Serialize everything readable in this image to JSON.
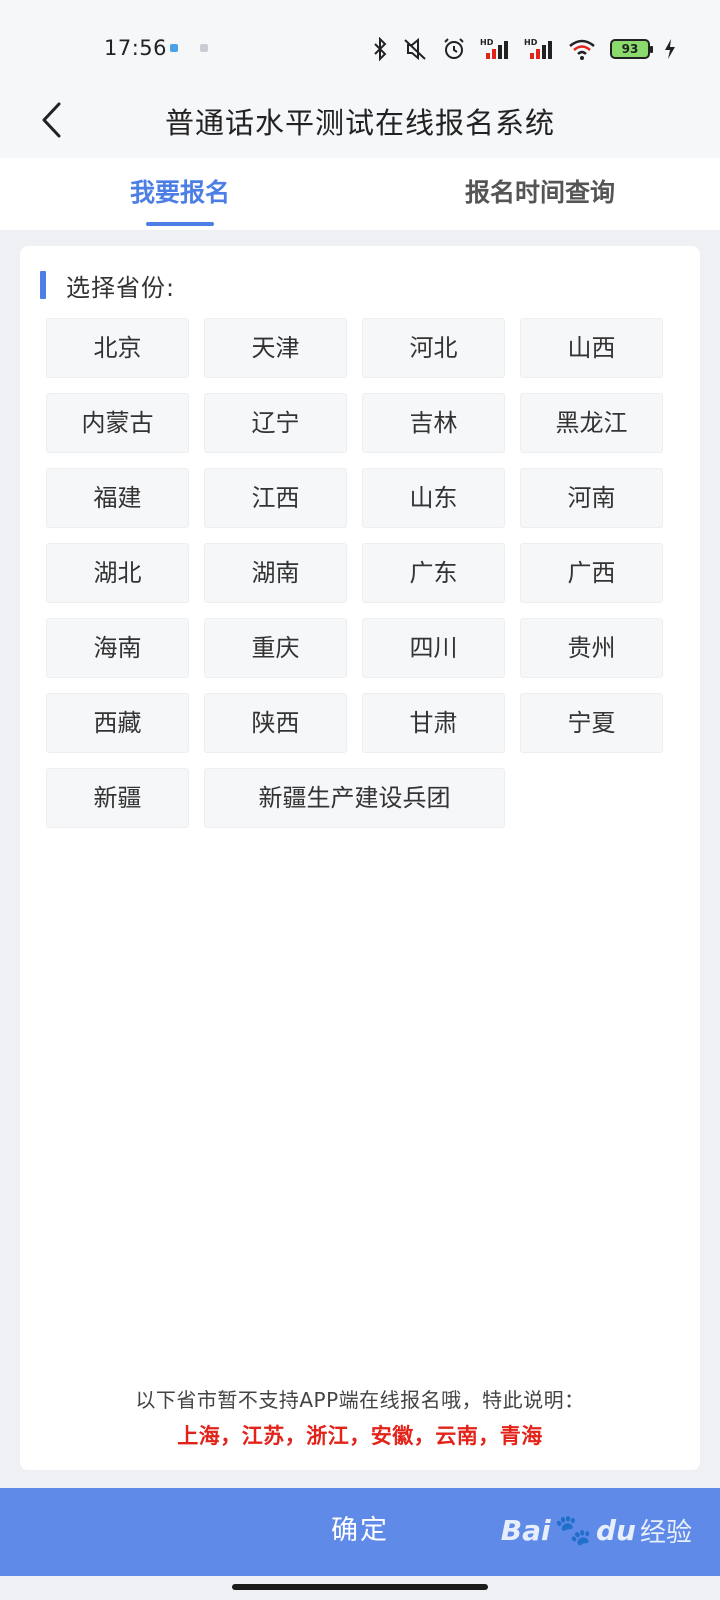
{
  "status_bar": {
    "time": "17:56",
    "icons": [
      "bluetooth-icon",
      "mute-icon",
      "alarm-icon",
      "signal-hd-icon",
      "signal-hd-icon",
      "wifi-icon",
      "battery-icon",
      "charging-icon"
    ],
    "battery_level": "93"
  },
  "header": {
    "title": "普通话水平测试在线报名系统",
    "back_icon": "chevron-left-icon"
  },
  "tabs": [
    {
      "label": "我要报名",
      "active": true
    },
    {
      "label": "报名时间查询",
      "active": false
    }
  ],
  "section": {
    "label": "选择省份:"
  },
  "provinces": [
    "北京",
    "天津",
    "河北",
    "山西",
    "内蒙古",
    "辽宁",
    "吉林",
    "黑龙江",
    "福建",
    "江西",
    "山东",
    "河南",
    "湖北",
    "湖南",
    "广东",
    "广西",
    "海南",
    "重庆",
    "四川",
    "贵州",
    "西藏",
    "陕西",
    "甘肃",
    "宁夏",
    "新疆",
    "新疆生产建设兵团"
  ],
  "notice": {
    "text": "以下省市暂不支持APP端在线报名哦，特此说明：",
    "unsupported": "上海，江苏，浙江，安徽，云南，青海"
  },
  "confirm_label": "确定",
  "watermark": {
    "brand": "Bai",
    "brand_suffix": "du",
    "product": "经验"
  },
  "colors": {
    "accent": "#4c7ee6",
    "button": "#5f8ae8",
    "warning": "#e2231a"
  }
}
